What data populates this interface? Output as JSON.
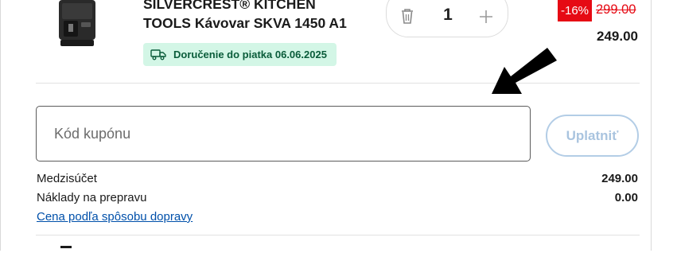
{
  "product": {
    "name_line1": "SILVERCREST® KITCHEN",
    "name_line2": "TOOLS Kávovar SKVA 1450 A1",
    "delivery_text": "Doručenie do piatka 06.06.2025",
    "quantity": "1",
    "discount": "-16%",
    "old_price": "299.00",
    "price": "249.00"
  },
  "icons": {
    "trash": "trash-icon",
    "plus": "plus-icon",
    "truck": "delivery-truck-icon",
    "arrow": "pointer-arrow-icon"
  },
  "coupon": {
    "placeholder": "Kód kupónu",
    "value": "",
    "apply_label": "Uplatniť"
  },
  "summary": {
    "subtotal_label": "Medzisúčet",
    "subtotal_value": "249.00",
    "shipping_label": "Náklady na prepravu",
    "shipping_value": "0.00",
    "shipping_link": "Cena podľa spôsobu dopravy"
  },
  "colors": {
    "discount_red": "#e60a14",
    "delivery_bg": "#d3f6e6",
    "link_blue": "#0050aa",
    "apply_disabled": "#a9c4df"
  }
}
